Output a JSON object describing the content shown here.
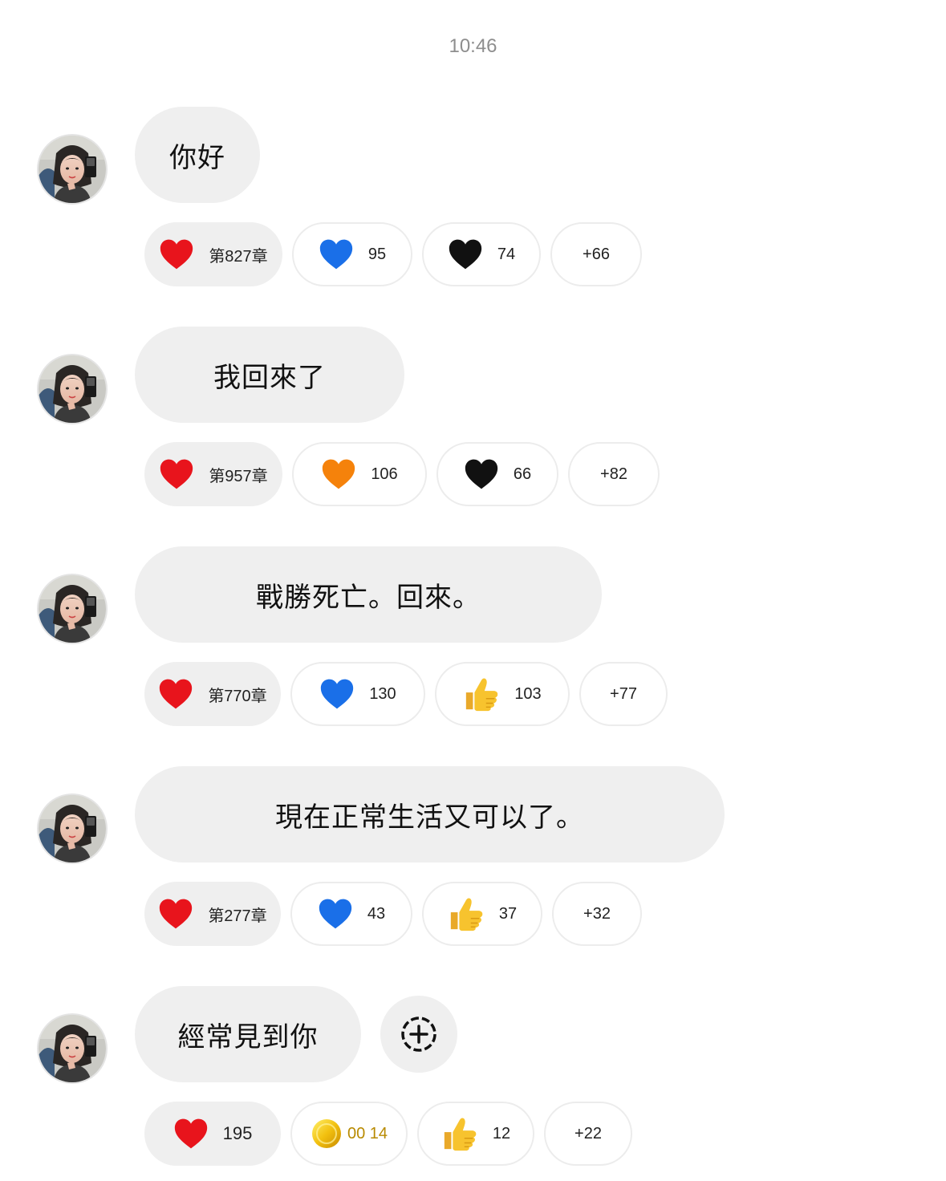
{
  "header": {
    "time": "10:46"
  },
  "colors": {
    "bubble_bg": "#efefef",
    "red_heart": "#e8141c",
    "blue_heart": "#1a6fe8",
    "orange_heart": "#f5820b",
    "black_heart": "#111111",
    "thumbs_yellow": "#f7c32e",
    "coin_yellow": "#f2c00f"
  },
  "messages": [
    {
      "text": "你好",
      "reactions": [
        {
          "icon": "red-heart-icon",
          "count": "第827章"
        },
        {
          "icon": "blue-heart-icon",
          "count": "95"
        },
        {
          "icon": "black-heart-icon",
          "count": "74"
        }
      ],
      "more": "+66"
    },
    {
      "text": "我回來了",
      "reactions": [
        {
          "icon": "red-heart-icon",
          "count": "第957章"
        },
        {
          "icon": "orange-heart-icon",
          "count": "106"
        },
        {
          "icon": "black-heart-icon",
          "count": "66"
        }
      ],
      "more": "+82"
    },
    {
      "text": "戰勝死亡。回來。",
      "reactions": [
        {
          "icon": "red-heart-icon",
          "count": "第770章"
        },
        {
          "icon": "blue-heart-icon",
          "count": "130"
        },
        {
          "icon": "thumbs-up-icon",
          "count": "103"
        }
      ],
      "more": "+77"
    },
    {
      "text": "現在正常生活又可以了。",
      "reactions": [
        {
          "icon": "red-heart-icon",
          "count": "第277章"
        },
        {
          "icon": "blue-heart-icon",
          "count": "43"
        },
        {
          "icon": "thumbs-up-icon",
          "count": "37"
        }
      ],
      "more": "+32"
    },
    {
      "text": "經常見到你",
      "reactions": [
        {
          "icon": "red-heart-icon",
          "count": "195"
        },
        {
          "icon": "coin-icon",
          "count": "00 14"
        },
        {
          "icon": "thumbs-up-icon",
          "count": "12"
        }
      ],
      "more": "+22"
    }
  ]
}
